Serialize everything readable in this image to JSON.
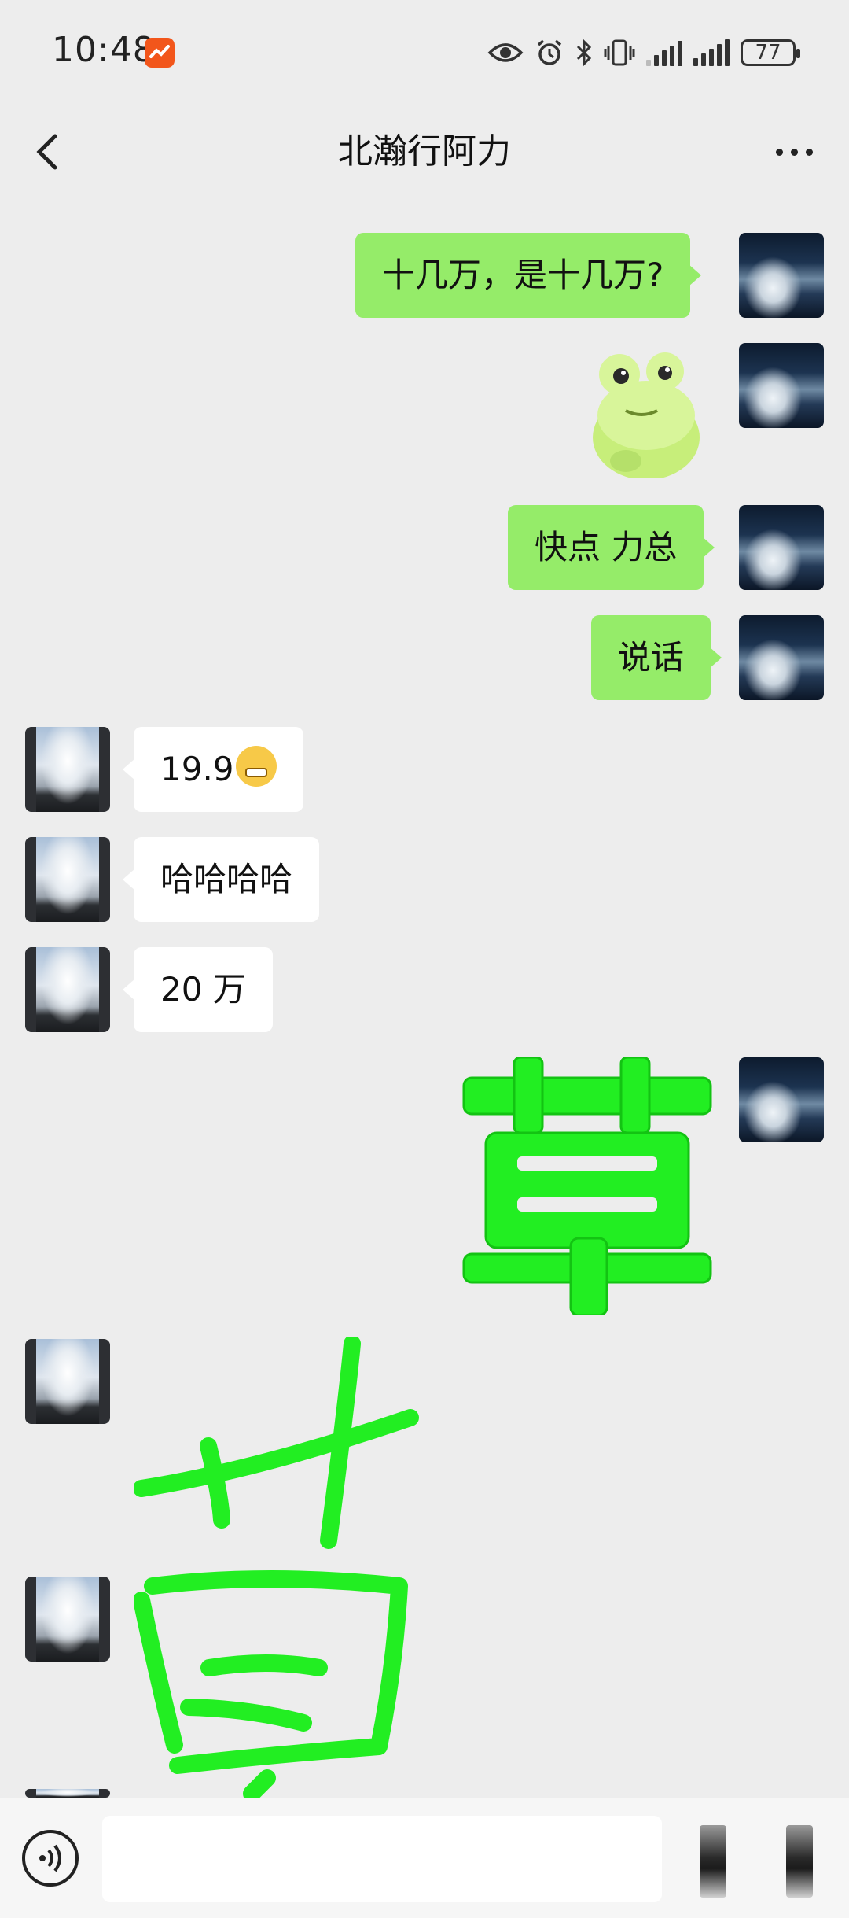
{
  "status": {
    "time": "10:48",
    "battery": "77"
  },
  "header": {
    "title": "北瀚行阿力"
  },
  "messages": [
    {
      "side": "out",
      "text": "十几万，是十几万?"
    },
    {
      "side": "out",
      "sticker": "frog-sticker"
    },
    {
      "side": "out",
      "text": "快点 力总"
    },
    {
      "side": "out",
      "text": "说话"
    },
    {
      "side": "in",
      "text": "19.9",
      "emoji": "grimacing-face-emoji"
    },
    {
      "side": "in",
      "text": "哈哈哈哈"
    },
    {
      "side": "in",
      "text": "20 万"
    },
    {
      "side": "out",
      "sticker": "grass-character-sticker"
    },
    {
      "side": "in",
      "sticker": "handwritten-green-character-sticker"
    }
  ],
  "colors": {
    "outgoing_bubble": "#95ec69",
    "incoming_bubble": "#ffffff",
    "background": "#ededed",
    "sticker_green": "#22ee22"
  },
  "icons": {
    "back": "chevron-left-icon",
    "more": "more-dots-icon",
    "voice": "voice-input-icon"
  }
}
